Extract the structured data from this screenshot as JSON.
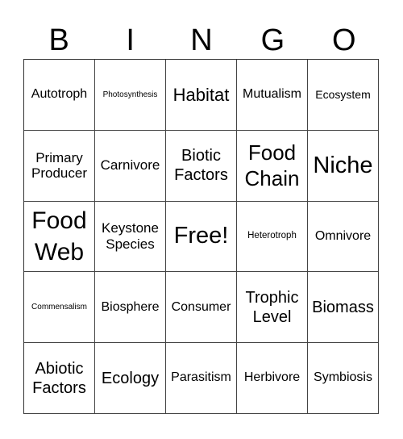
{
  "header": [
    "B",
    "I",
    "N",
    "G",
    "O"
  ],
  "cells": [
    {
      "text": "Autotroph",
      "size": "s15"
    },
    {
      "text": "Photosynthesis",
      "size": "s10"
    },
    {
      "text": "Habitat",
      "size": "s22"
    },
    {
      "text": "Mutualism",
      "size": "s15"
    },
    {
      "text": "Ecosystem",
      "size": "s13"
    },
    {
      "text": "Primary Producer",
      "size": "s17"
    },
    {
      "text": "Carnivore",
      "size": "s17"
    },
    {
      "text": "Biotic Factors",
      "size": "s20"
    },
    {
      "text": "Food Chain",
      "size": "s26"
    },
    {
      "text": "Niche",
      "size": "s28"
    },
    {
      "text": "Food Web",
      "size": "s30"
    },
    {
      "text": "Keystone Species",
      "size": "s17"
    },
    {
      "text": "Free!",
      "size": "s28"
    },
    {
      "text": "Heterotroph",
      "size": "s11"
    },
    {
      "text": "Omnivore",
      "size": "s15"
    },
    {
      "text": "Commensalism",
      "size": "s10"
    },
    {
      "text": "Biosphere",
      "size": "s15"
    },
    {
      "text": "Consumer",
      "size": "s15"
    },
    {
      "text": "Trophic Level",
      "size": "s20"
    },
    {
      "text": "Biomass",
      "size": "s20"
    },
    {
      "text": "Abiotic Factors",
      "size": "s20"
    },
    {
      "text": "Ecology",
      "size": "s20"
    },
    {
      "text": "Parasitism",
      "size": "s15"
    },
    {
      "text": "Herbivore",
      "size": "s15"
    },
    {
      "text": "Symbiosis",
      "size": "s15"
    }
  ]
}
